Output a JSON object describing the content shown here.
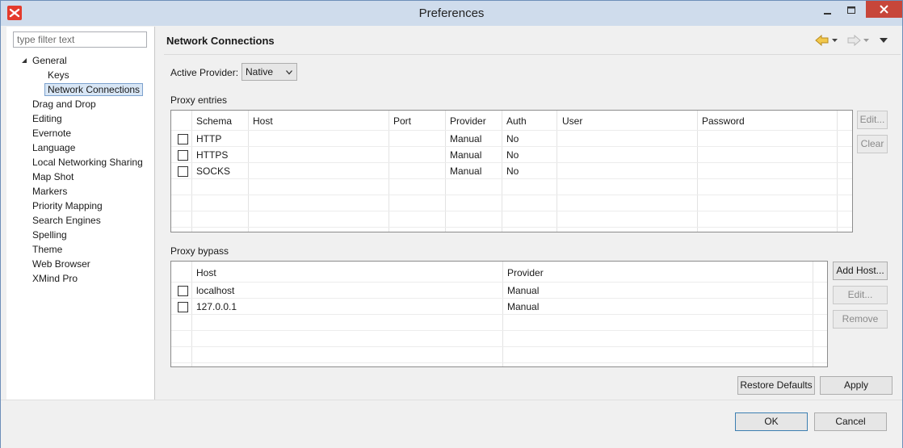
{
  "window": {
    "title": "Preferences"
  },
  "filter": {
    "placeholder": "type filter text"
  },
  "tree": {
    "general": "General",
    "children": [
      "Keys",
      "Network Connections"
    ],
    "items": [
      "Drag and Drop",
      "Editing",
      "Evernote",
      "Language",
      "Local Networking Sharing",
      "Map Shot",
      "Markers",
      "Priority Mapping",
      "Search Engines",
      "Spelling",
      "Theme",
      "Web Browser",
      "XMind Pro"
    ],
    "selected": "Network Connections"
  },
  "page": {
    "title": "Network Connections",
    "active_provider_label": "Active Provider:",
    "active_provider_value": "Native",
    "proxy_entries_label": "Proxy entries",
    "proxy_bypass_label": "Proxy bypass"
  },
  "proxy_entries": {
    "columns": [
      "Schema",
      "Host",
      "Port",
      "Provider",
      "Auth",
      "User",
      "Password"
    ],
    "rows": [
      {
        "schema": "HTTP",
        "host": "",
        "port": "",
        "provider": "Manual",
        "auth": "No",
        "user": "",
        "password": ""
      },
      {
        "schema": "HTTPS",
        "host": "",
        "port": "",
        "provider": "Manual",
        "auth": "No",
        "user": "",
        "password": ""
      },
      {
        "schema": "SOCKS",
        "host": "",
        "port": "",
        "provider": "Manual",
        "auth": "No",
        "user": "",
        "password": ""
      }
    ],
    "buttons": {
      "edit": "Edit...",
      "clear": "Clear"
    }
  },
  "proxy_bypass": {
    "columns": [
      "Host",
      "Provider"
    ],
    "rows": [
      {
        "host": "localhost",
        "provider": "Manual"
      },
      {
        "host": "127.0.0.1",
        "provider": "Manual"
      }
    ],
    "buttons": {
      "add_host": "Add Host...",
      "edit": "Edit...",
      "remove": "Remove"
    }
  },
  "page_buttons": {
    "restore_defaults": "Restore Defaults",
    "apply": "Apply"
  },
  "dialog_buttons": {
    "ok": "OK",
    "cancel": "Cancel"
  },
  "colors": {
    "selection_bg": "#d8e6f5",
    "selection_border": "#7da2ce",
    "close_button": "#c7463a",
    "titlebar": "#cfdcec",
    "nav_back_arrow": "#e2b13c"
  }
}
